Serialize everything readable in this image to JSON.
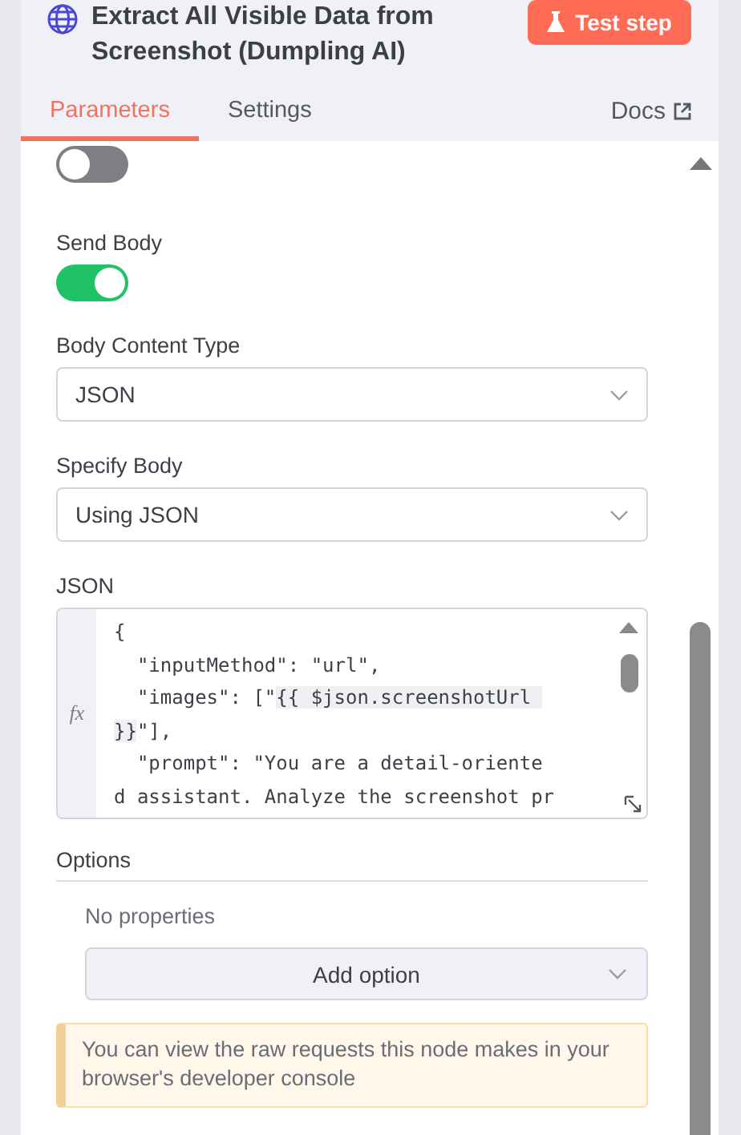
{
  "header": {
    "title": "Extract All Visible Data from Screenshot (Dumpling AI)",
    "test_button": "Test step"
  },
  "tabs": [
    {
      "label": "Parameters",
      "selected": true
    },
    {
      "label": "Settings",
      "selected": false
    }
  ],
  "docs_link": "Docs",
  "fields": [
    {
      "kind": "toggle",
      "on": false
    },
    {
      "kind": "toggle",
      "label": "Send Body",
      "on": true
    },
    {
      "kind": "select",
      "label": "Body Content Type",
      "value": "JSON"
    },
    {
      "kind": "select",
      "label": "Specify Body",
      "value": "Using JSON"
    },
    {
      "kind": "code",
      "label": "JSON",
      "prefix": "fx",
      "lines": [
        [
          {
            "text": "{",
            "kind": "plain"
          }
        ],
        [
          {
            "text": "  \"inputMethod\": \"url\",",
            "kind": "plain"
          }
        ],
        [
          {
            "text": "  \"images\": [\"",
            "kind": "plain"
          },
          {
            "text": "{{ $json.screenshotUrl ",
            "kind": "expression"
          }
        ],
        [
          {
            "text": "}}",
            "kind": "expression"
          },
          {
            "text": "\"],",
            "kind": "plain"
          }
        ],
        [
          {
            "text": "  \"prompt\": \"You are a detail-oriente",
            "kind": "plain"
          }
        ],
        [
          {
            "text": "d assistant. Analyze the screenshot pr",
            "kind": "plain"
          }
        ]
      ]
    }
  ],
  "options": {
    "title": "Options",
    "empty_text": "No properties",
    "add_button": "Add option"
  },
  "notice": "You can view the raw requests this node makes in your browser's developer console"
}
